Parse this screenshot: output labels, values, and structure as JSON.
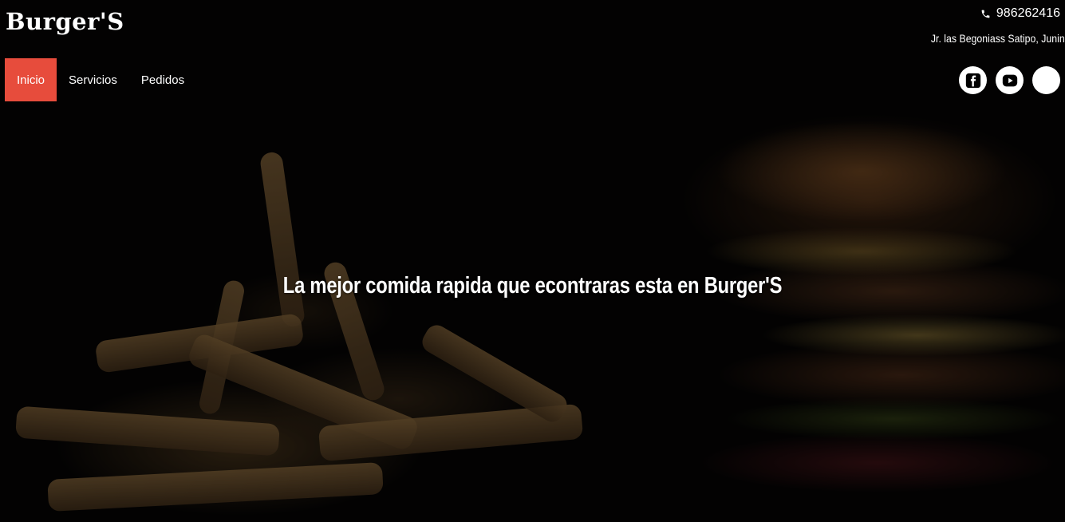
{
  "brand": {
    "name": "Burger'S"
  },
  "contact": {
    "phone": "986262416",
    "address": "Jr. las Begoniass Satipo, Junin"
  },
  "nav": {
    "items": [
      {
        "label": "Inicio",
        "active": true
      },
      {
        "label": "Servicios",
        "active": false
      },
      {
        "label": "Pedidos",
        "active": false
      }
    ]
  },
  "socials": [
    "facebook-icon",
    "youtube-icon",
    "blank-social-icon"
  ],
  "hero": {
    "headline": "La mejor comida rapida que econtraras esta en Burger'S"
  },
  "colors": {
    "accent": "#e74c3c",
    "background": "#000000",
    "text": "#ffffff"
  }
}
